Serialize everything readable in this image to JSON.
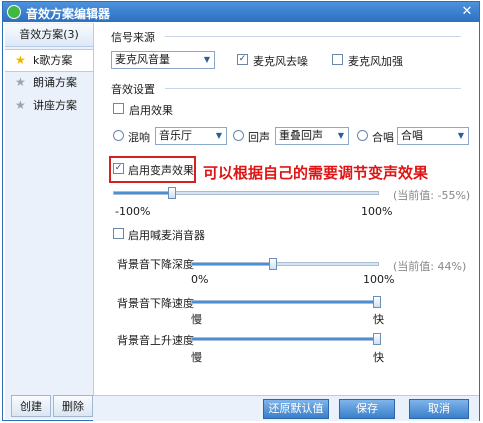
{
  "window": {
    "title": "音效方案编辑器",
    "close_glyph": "✕"
  },
  "sidebar": {
    "header": "音效方案(3)",
    "items": [
      {
        "label": "k歌方案",
        "selected": true,
        "icon": "star-icon"
      },
      {
        "label": "朗诵方案",
        "selected": false,
        "icon": "star-icon"
      },
      {
        "label": "讲座方案",
        "selected": false,
        "icon": "star-icon"
      }
    ],
    "create_label": "创建",
    "delete_label": "删除"
  },
  "signal": {
    "section_label": "信号来源",
    "source_value": "麦克风音量",
    "mic_denoise_label": "麦克风去噪",
    "mic_denoise_checked": true,
    "mic_boost_label": "麦克风加强",
    "mic_boost_checked": false
  },
  "effects": {
    "section_label": "音效设置",
    "enable_effects_label": "启用效果",
    "enable_effects_checked": false,
    "reverb_label": "混响",
    "reverb_value": "音乐厅",
    "echo_label": "回声",
    "echo_value": "重叠回声",
    "chorus_label": "合唱",
    "chorus_value": "合唱",
    "voice_change_label": "启用变声效果",
    "voice_change_checked": true,
    "voice_slider": {
      "min_label": "-100%",
      "max_label": "100%",
      "current_text": "(当前值: -55%)",
      "value_percent": -55
    },
    "annotation": "可以根据自己的需要调节变声效果",
    "vocal_remover_label": "启用喊麦消音器",
    "vocal_remover_checked": false,
    "bg_depth_label": "背景音下降深度",
    "bg_depth": {
      "min_label": "0%",
      "max_label": "100%",
      "current_text": "(当前值: 44%)",
      "value_fraction": 0.44
    },
    "bg_fall_speed_label": "背景音下降速度",
    "bg_fall_speed": {
      "min_label": "慢",
      "max_label": "快",
      "value_fraction": 1.0
    },
    "bg_rise_speed_label": "背景音上升速度",
    "bg_rise_speed": {
      "min_label": "慢",
      "max_label": "快",
      "value_fraction": 1.0
    }
  },
  "footer": {
    "restore_label": "还原默认值",
    "save_label": "保存",
    "cancel_label": "取消"
  },
  "colors": {
    "accent": "#2c70c2",
    "annotation": "#e01414"
  }
}
